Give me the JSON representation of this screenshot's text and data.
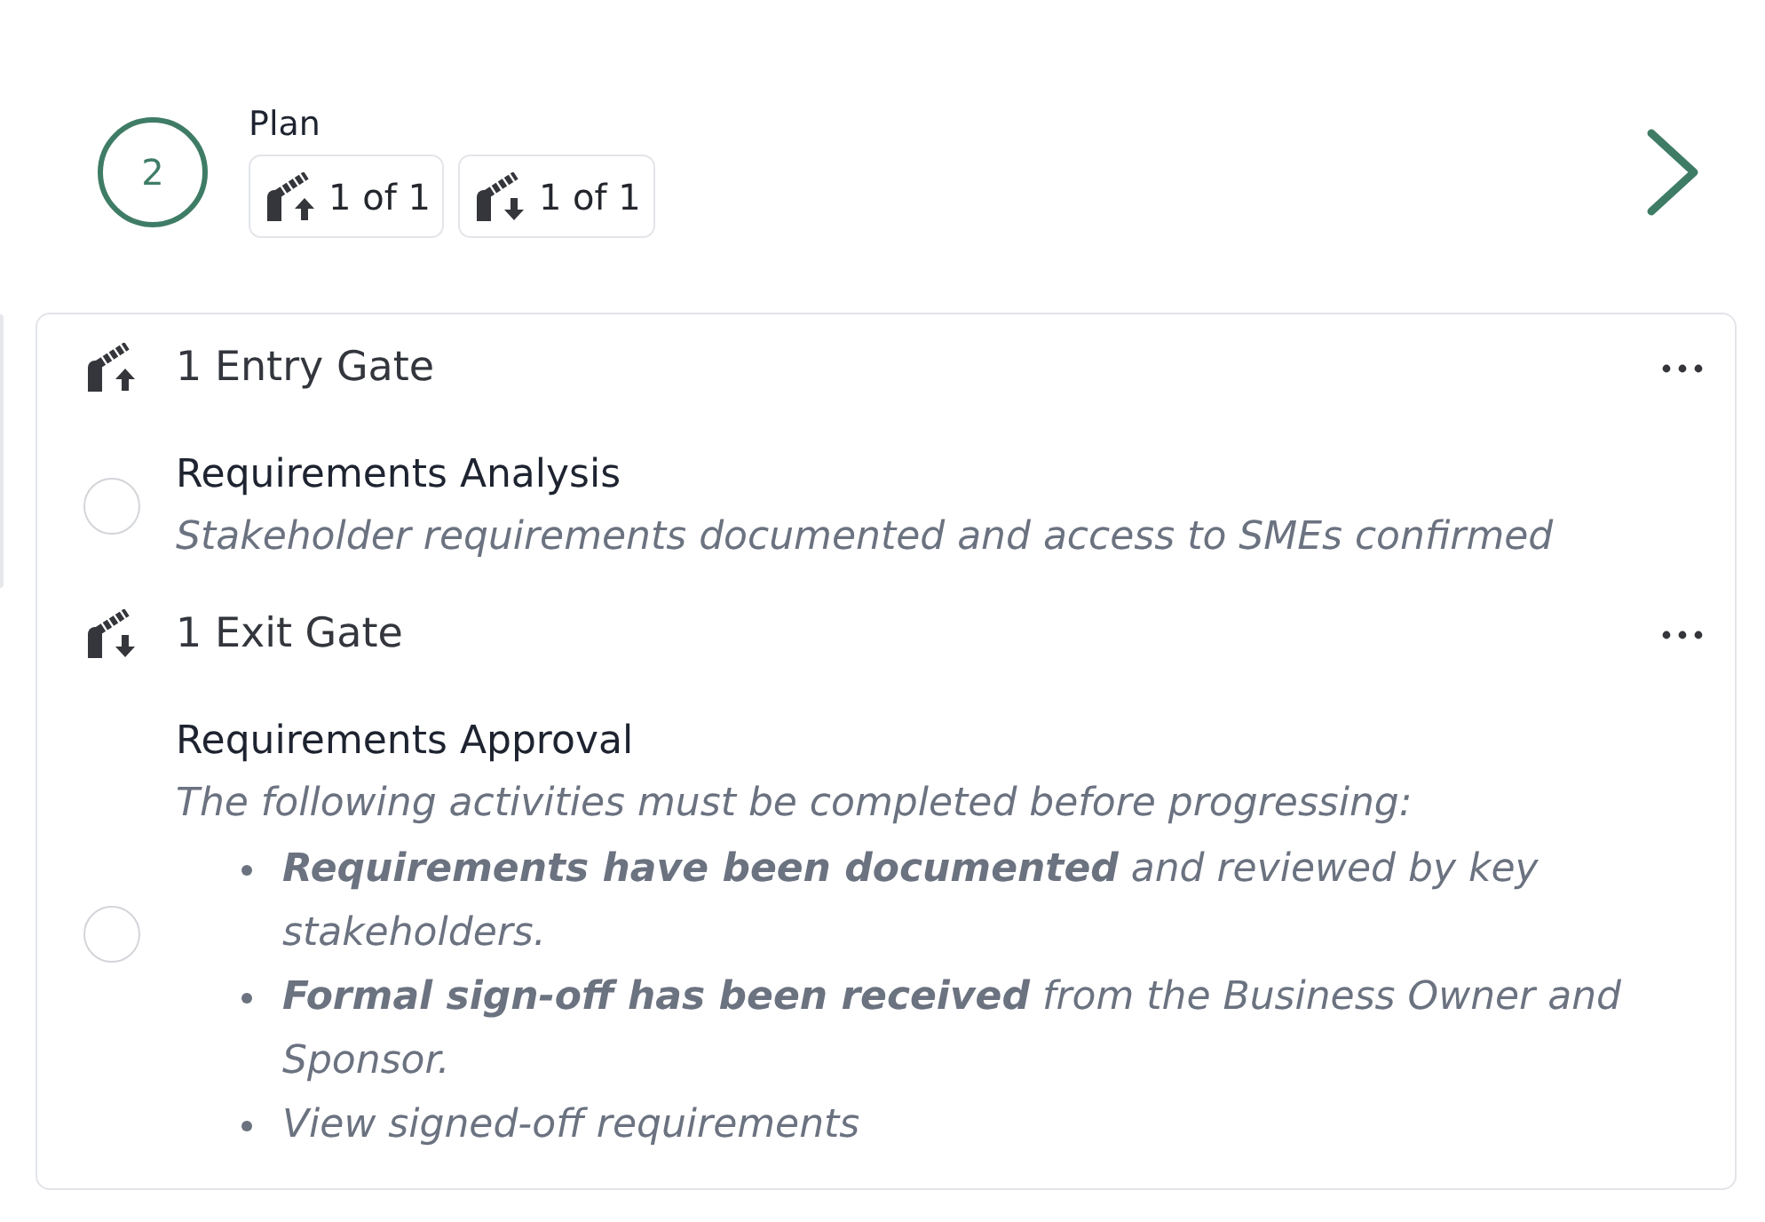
{
  "step": {
    "number": "2",
    "title": "Plan"
  },
  "gate_counts": [
    {
      "kind": "entry",
      "text": "1 of 1"
    },
    {
      "kind": "exit",
      "text": "1 of 1"
    }
  ],
  "gates": [
    {
      "kind": "entry",
      "title": "1 Entry Gate",
      "items": [
        {
          "title": "Requirements Analysis",
          "checked": false,
          "description": "Stakeholder requirements documented and access to SMEs confirmed"
        }
      ]
    },
    {
      "kind": "exit",
      "title": "1 Exit Gate",
      "items": [
        {
          "title": "Requirements Approval",
          "checked": false,
          "description": "The following activities must be completed before progressing:",
          "bullets": [
            "**Requirements have been documented** and reviewed by key stakeholders.",
            "**Formal sign-off has been received** from the Business Owner and Sponsor.",
            "View signed-off requirements"
          ]
        }
      ]
    }
  ]
}
